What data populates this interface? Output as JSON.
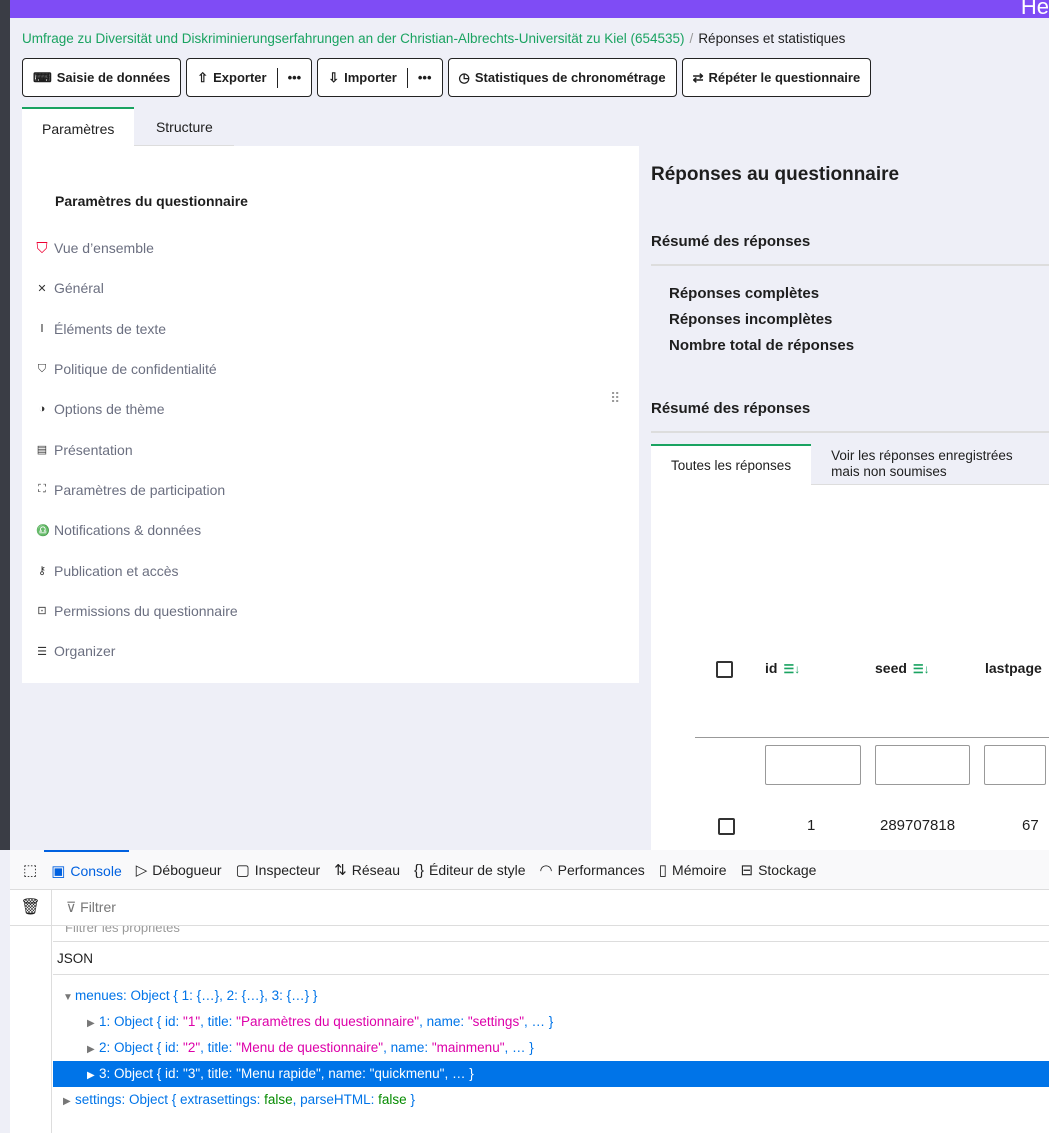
{
  "topbar": {
    "text": "He"
  },
  "breadcrumb": {
    "survey": "Umfrage zu Diversität und Diskriminierungserfahrungen an der Christian-Albrechts-Universität zu Kiel (654535)",
    "separator": "/",
    "current": "Réponses et statistiques"
  },
  "toolbar": {
    "data_entry": "Saisie de données",
    "export": "Exporter",
    "import": "Importer",
    "timing": "Statistiques de chronométrage",
    "repeat": "Répéter le questionnaire",
    "more": "•••"
  },
  "tabs": {
    "settings": "Paramètres",
    "structure": "Structure"
  },
  "sidebar": {
    "title": "Paramètres du questionnaire",
    "items": [
      {
        "label": "Vue d’ensemble",
        "icon": "shield-icon"
      },
      {
        "label": "Général",
        "icon": "tools-icon"
      },
      {
        "label": "Éléments de texte",
        "icon": "text-icon"
      },
      {
        "label": "Politique de confidentialité",
        "icon": "shield-outline-icon"
      },
      {
        "label": "Options de thème",
        "icon": "contrast-icon"
      },
      {
        "label": "Présentation",
        "icon": "layout-icon"
      },
      {
        "label": "Paramètres de participation",
        "icon": "participants-icon"
      },
      {
        "label": "Notifications & données",
        "icon": "bell-icon"
      },
      {
        "label": "Publication et accès",
        "icon": "key-icon"
      },
      {
        "label": "Permissions du questionnaire",
        "icon": "lock-icon"
      },
      {
        "label": "Organizer",
        "icon": "list-icon"
      }
    ]
  },
  "main": {
    "title": "Réponses au questionnaire",
    "summary1": "Résumé des réponses",
    "stats": [
      "Réponses complètes",
      "Réponses incomplètes",
      "Nombre total de réponses"
    ],
    "summary2": "Résumé des réponses",
    "tabs": [
      "Toutes les réponses",
      "Voir les réponses enregistrées mais non soumises"
    ],
    "columns": [
      "id",
      "seed",
      "lastpage"
    ],
    "row": {
      "id": "1",
      "seed": "289707818",
      "lastpage": "67"
    }
  },
  "devtools": {
    "tabs": [
      "Console",
      "Débogueur",
      "Inspecteur",
      "Réseau",
      "Éditeur de style",
      "Performances",
      "Mémoire",
      "Stockage"
    ],
    "filter": "Filtrer",
    "ghost": "Filtrer les propriétés",
    "json_label": "JSON",
    "lines": {
      "menues_key": "menues:",
      "menues_val": "Object { 1: {…}, 2: {…}, 3: {…} }",
      "m1a": "1: Object { id: ",
      "m1id": "\"1\"",
      "m1b": ", title: ",
      "m1t": "\"Paramètres du questionnaire\"",
      "m1c": ", name: ",
      "m1n": "\"settings\"",
      "m1d": ", … }",
      "m2a": "2: Object { id: ",
      "m2id": "\"2\"",
      "m2b": ", title: ",
      "m2t": "\"Menu de questionnaire\"",
      "m2c": ", name: ",
      "m2n": "\"mainmenu\"",
      "m2d": ", … }",
      "m3a": "3: Object { id: ",
      "m3id": "\"3\"",
      "m3b": ", title: ",
      "m3t": "\"Menu rapide\"",
      "m3c": ", name: ",
      "m3n": "\"quickmenu\"",
      "m3d": ", … }",
      "s_a": "settings: Object { extrasettings: ",
      "s_v1": "false",
      "s_b": ", parseHTML: ",
      "s_v2": "false",
      "s_c": " }"
    }
  }
}
